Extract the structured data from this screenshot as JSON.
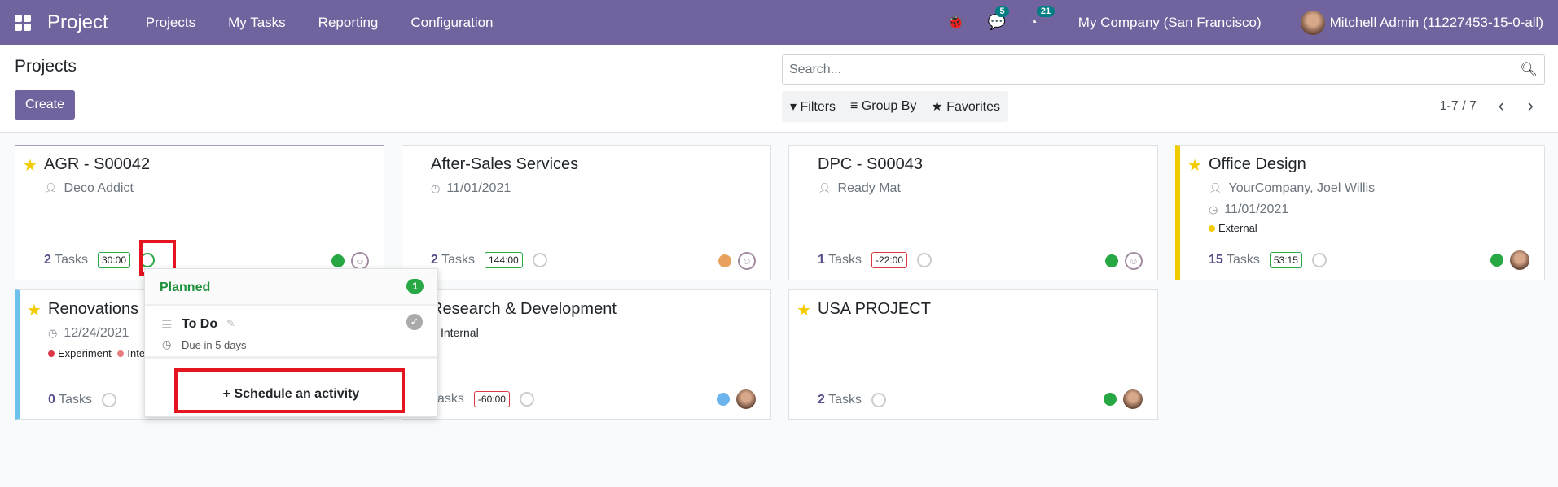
{
  "nav": {
    "brand": "Project",
    "menus": [
      "Projects",
      "My Tasks",
      "Reporting",
      "Configuration"
    ],
    "messages_count": "5",
    "activities_count": "21",
    "company": "My Company (San Francisco)",
    "user": "Mitchell Admin (11227453-15-0-all)",
    "color": "#71639e"
  },
  "control": {
    "title": "Projects",
    "create": "Create",
    "search_placeholder": "Search...",
    "filters": "Filters",
    "group_by": "Group By",
    "favorites": "Favorites",
    "pager": "1-7 / 7"
  },
  "cards": [
    {
      "name": "AGR - S00042",
      "starred": true,
      "customer": "Deco Addict",
      "tasks_num": "2",
      "tasks_label": "Tasks",
      "hours": "30:00",
      "status": "green"
    },
    {
      "name": "After-Sales Services",
      "starred": false,
      "date": "11/01/2021",
      "tasks_num": "2",
      "tasks_label": "Tasks",
      "hours": "144:00",
      "status": "orange"
    },
    {
      "name": "DPC - S00043",
      "starred": false,
      "customer": "Ready Mat",
      "tasks_num": "1",
      "tasks_label": "Tasks",
      "hours": "-22:00",
      "status": "green"
    },
    {
      "name": "Office Design",
      "starred": true,
      "customer": "YourCompany, Joel Willis",
      "date": "11/01/2021",
      "tag": "External",
      "tasks_num": "15",
      "tasks_label": "Tasks",
      "hours": "53:15",
      "status": "green"
    },
    {
      "name": "Renovations",
      "starred": true,
      "date": "12/24/2021",
      "tags": [
        "Experiment",
        "Inte"
      ],
      "tasks_num": "0",
      "tasks_label": "Tasks"
    },
    {
      "name": "Research & Development",
      "starred": false,
      "tag": "Internal",
      "tasks_label": "Tasks",
      "hours": "-60:00",
      "status": "blue"
    },
    {
      "name": "USA PROJECT",
      "starred": true,
      "tasks_num": "2",
      "tasks_label": "Tasks",
      "status": "green"
    }
  ],
  "popup": {
    "group": "Planned",
    "count": "1",
    "activity": "To Do",
    "due": "Due in 5 days",
    "schedule": "Schedule an activity"
  }
}
